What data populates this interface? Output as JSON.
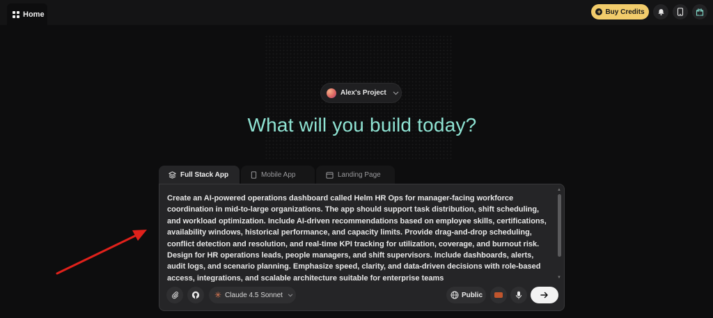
{
  "topbar": {
    "home_tab": "Home",
    "buy_credits": "Buy Credits",
    "icons": [
      "bell-icon",
      "phone-icon",
      "gift-icon"
    ]
  },
  "project": {
    "name": "Alex's Project"
  },
  "headline": "What will you build today?",
  "tabs": [
    {
      "label": "Full Stack App",
      "icon": "layers-icon",
      "active": true
    },
    {
      "label": "Mobile App",
      "icon": "phone-icon",
      "active": false
    },
    {
      "label": "Landing Page",
      "icon": "browser-window-icon",
      "active": false
    }
  ],
  "prompt": {
    "value": "Create an AI-powered operations dashboard called Helm HR Ops for manager-facing workforce coordination in mid-to-large organizations. The app should support task distribution, shift scheduling, and workload optimization. Include AI-driven recommendations based on employee skills, certifications, availability windows, historical performance, and capacity limits. Provide drag-and-drop scheduling, conflict detection and resolution, and real-time KPI tracking for utilization, coverage, and burnout risk. Design for HR operations leads, people managers, and shift supervisors. Include dashboards, alerts, audit logs, and scenario planning. Emphasize speed, clarity, and data-driven decisions with role-based access, integrations, and scalable architecture suitable for enterprise teams"
  },
  "toolbar": {
    "model": "Claude 4.5 Sonnet",
    "visibility": "Public"
  },
  "colors": {
    "background": "#0d0d0e",
    "headline": "#8fe3d3",
    "buy_credits": "#f2cc6b",
    "annotation_arrow": "#e0211b"
  }
}
